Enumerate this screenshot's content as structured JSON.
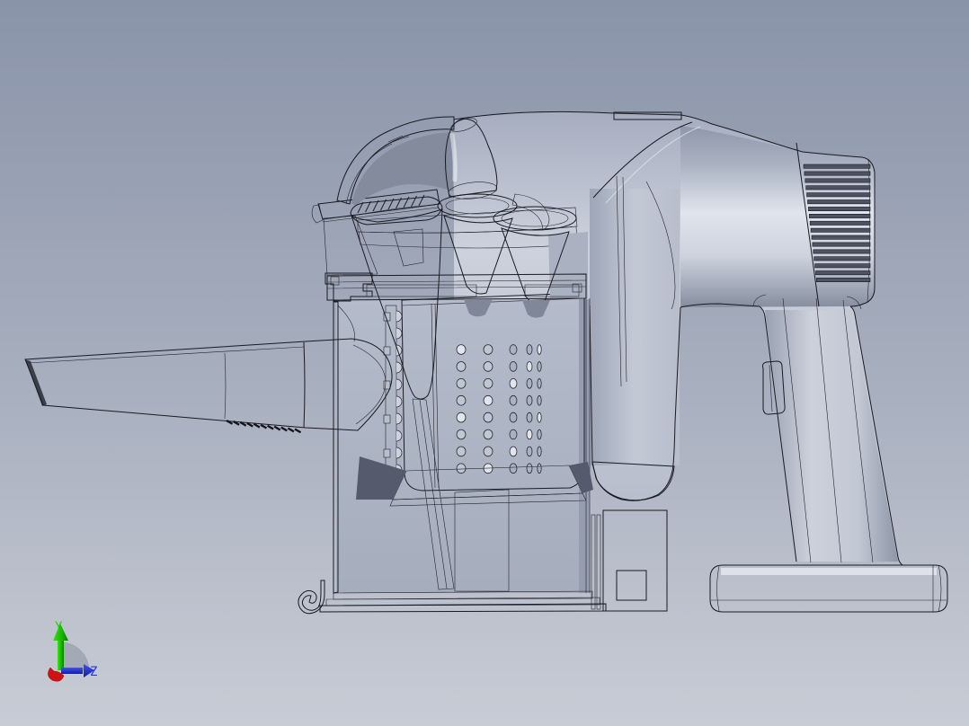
{
  "viewport": {
    "type": "3d-cad-view",
    "background_top": "#8a94a9",
    "background_bottom": "#c8ccd5"
  },
  "model": {
    "name": "handheld-vacuum-cross-section",
    "edge_color": "#1a1a22",
    "surface_color": "#bfc5d2",
    "parts": [
      "suction-nozzle",
      "nozzle-bell-mouth",
      "dust-bin",
      "bin-left-wall",
      "cyclone-cone",
      "cone-tail",
      "perforated-shroud",
      "shroud-holes",
      "cyclone-funnel-front",
      "cyclone-funnel-rear",
      "lid-seal-plate",
      "intake-elbow",
      "top-dome-arch",
      "mount-rail",
      "main-body",
      "motor-housing",
      "exhaust-vents",
      "handle",
      "trigger-latch",
      "battery-pack",
      "bin-latch-box",
      "floor-hook",
      "base-discs"
    ]
  },
  "triad": {
    "y_label": "Y",
    "y_color": "#1fd409",
    "z_label": "Z",
    "z_color": "#2438e8",
    "x_color": "#d01212",
    "disc_color": "#9098a6"
  }
}
